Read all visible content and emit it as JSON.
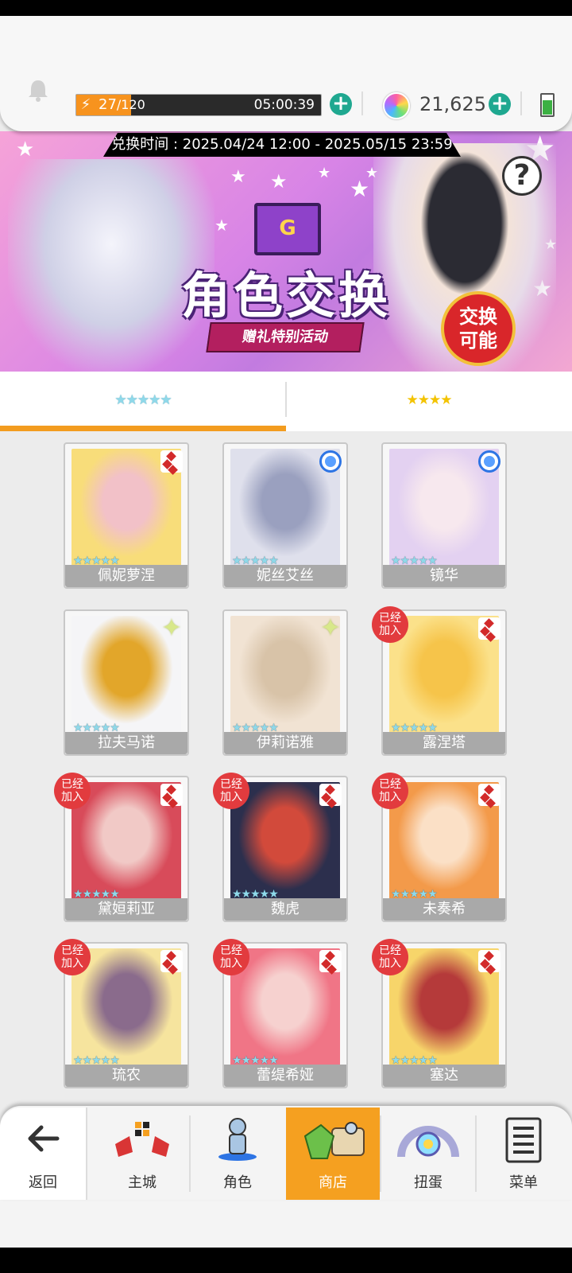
{
  "header": {
    "stamina_current": "27",
    "stamina_max": "/120",
    "stamina_fraction": 0.225,
    "stamina_timer": "05:00:39",
    "gems": "21,625"
  },
  "banner": {
    "exchange_time": "兑换时间 : 2025.04/24 12:00 - 2025.05/15 23:59",
    "title": "角色交换",
    "subtitle": "赠礼特别活动",
    "badge_line1": "交换",
    "badge_line2": "可能",
    "help": "?",
    "envelope_mark": "G"
  },
  "tabs": [
    {
      "label": "★★★★★"
    },
    {
      "label": "★★★★"
    }
  ],
  "cards": [
    {
      "name": "佩妮萝涅",
      "stars": "★★★★★",
      "element": "diamond",
      "joined": false,
      "colors": [
        "#f8dd7a",
        "#f2c1c8"
      ]
    },
    {
      "name": "妮丝艾丝",
      "stars": "★★★★★",
      "element": "circle",
      "joined": false,
      "colors": [
        "#dfe0ec",
        "#9aa0bf"
      ]
    },
    {
      "name": "镜华",
      "stars": "★★★★★",
      "element": "circle",
      "joined": false,
      "colors": [
        "#e3d1f1",
        "#f7e8ee"
      ]
    },
    {
      "name": "拉夫马诺",
      "stars": "★★★★★",
      "element": "spark",
      "joined": false,
      "colors": [
        "#f5f5f7",
        "#e2a62a"
      ]
    },
    {
      "name": "伊莉诺雅",
      "stars": "★★★★★",
      "element": "spark",
      "joined": false,
      "colors": [
        "#f1e3d3",
        "#d8c3a8"
      ]
    },
    {
      "name": "露涅塔",
      "stars": "★★★★★",
      "element": "diamond",
      "joined": true,
      "colors": [
        "#fbe18a",
        "#f6c44a"
      ]
    },
    {
      "name": "黛姮莉亚",
      "stars": "★★★★★",
      "element": "diamond",
      "joined": true,
      "colors": [
        "#d84b5a",
        "#f1c9c6"
      ]
    },
    {
      "name": "魏虎",
      "stars": "★★★★★",
      "element": "diamond",
      "joined": true,
      "colors": [
        "#2c2f4d",
        "#d24a3b"
      ]
    },
    {
      "name": "未奏希",
      "stars": "★★★★★",
      "element": "diamond",
      "joined": true,
      "colors": [
        "#f39a4a",
        "#fbe0c6"
      ]
    },
    {
      "name": "琉农",
      "stars": "★★★★★",
      "element": "diamond",
      "joined": true,
      "colors": [
        "#f6e49e",
        "#8a6b8c"
      ]
    },
    {
      "name": "蕾缇希娅",
      "stars": "★★★★★",
      "element": "diamond",
      "joined": true,
      "colors": [
        "#f07586",
        "#f6d1cf"
      ]
    },
    {
      "name": "塞达",
      "stars": "★★★★★",
      "element": "diamond",
      "joined": true,
      "colors": [
        "#f7d56a",
        "#b53a3a"
      ]
    }
  ],
  "joined_label_line1": "已经",
  "joined_label_line2": "加入",
  "nav": {
    "back": "返回",
    "items": [
      {
        "label": "主城",
        "icon": "castle-icon"
      },
      {
        "label": "角色",
        "icon": "character-icon"
      },
      {
        "label": "商店",
        "icon": "shop-icon"
      },
      {
        "label": "扭蛋",
        "icon": "gacha-icon"
      },
      {
        "label": "菜单",
        "icon": "menu-icon"
      }
    ]
  },
  "colors": {
    "accent_orange": "#f5a020",
    "teal_button": "#1fa890",
    "joined_red": "#e23b3e"
  }
}
